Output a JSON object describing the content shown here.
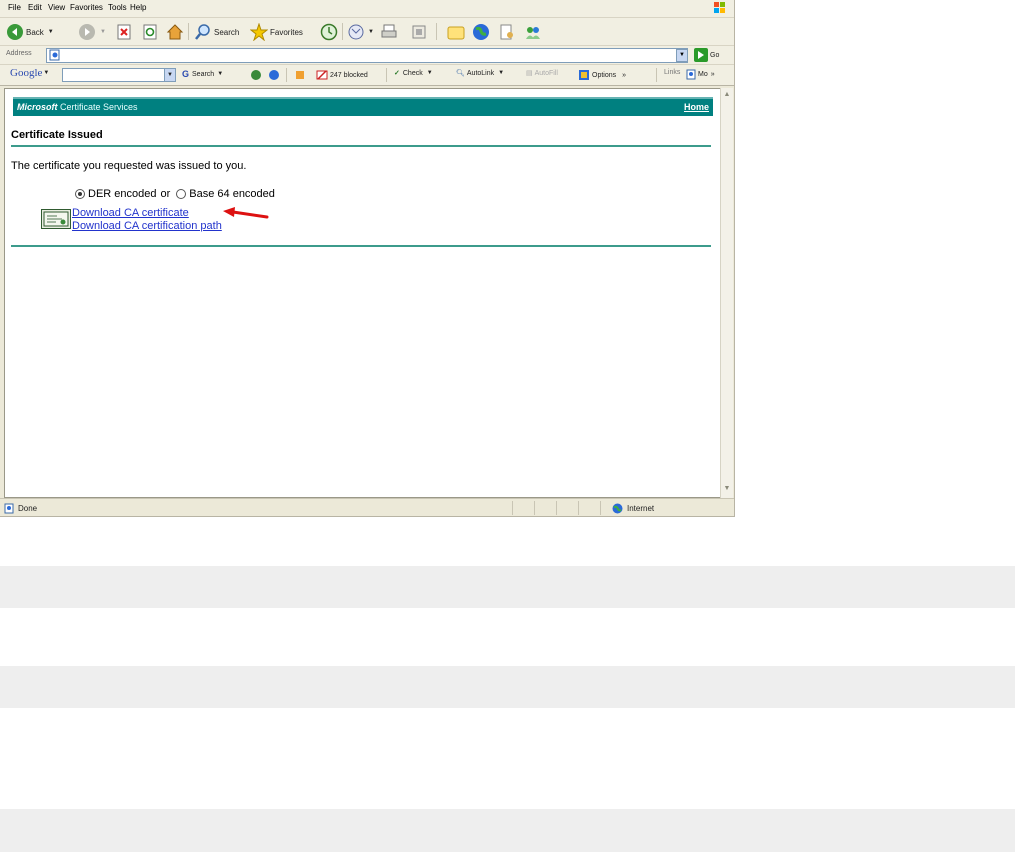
{
  "menu": {
    "items": [
      "File",
      "Edit",
      "View",
      "Favorites",
      "Tools",
      "Help"
    ]
  },
  "toolbar": {
    "back_label": "Back",
    "search_label": "Search",
    "favorites_label": "Favorites"
  },
  "address": {
    "label": "Address",
    "go_label": "Go"
  },
  "googlebar": {
    "brand": "Google",
    "search_label": "Search",
    "blocked_label": "247 blocked",
    "check_label": "Check",
    "autolink_label": "AutoLink",
    "autofill_label": "AutoFill",
    "options_label": "Options",
    "links_label": "Links",
    "more_label": "Mo"
  },
  "page": {
    "banner_brand": "Microsoft",
    "banner_service": "Certificate Services",
    "home_link": "Home",
    "title": "Certificate Issued",
    "message": "The certificate you requested was issued to you.",
    "der_label": "DER encoded",
    "or_label": "or",
    "base64_label": "Base 64 encoded",
    "download_cert_link": "Download CA certificate",
    "download_path_link": "Download CA certification path"
  },
  "status": {
    "text": "Done",
    "zone": "Internet"
  },
  "colors": {
    "banner": "#008080",
    "rule": "#3c9b8c",
    "link": "#2233cc",
    "arrow": "#dd1111"
  },
  "icons": [
    "windows-flag-icon",
    "back-icon",
    "forward-icon",
    "stop-icon",
    "refresh-icon",
    "home-icon",
    "search-icon",
    "favorites-icon",
    "history-icon",
    "mail-icon",
    "print-icon",
    "edit-icon",
    "folder-icon",
    "globe-icon",
    "messenger-icon",
    "go-icon",
    "certificate-icon",
    "red-arrow-icon",
    "internet-zone-icon",
    "done-page-icon"
  ]
}
